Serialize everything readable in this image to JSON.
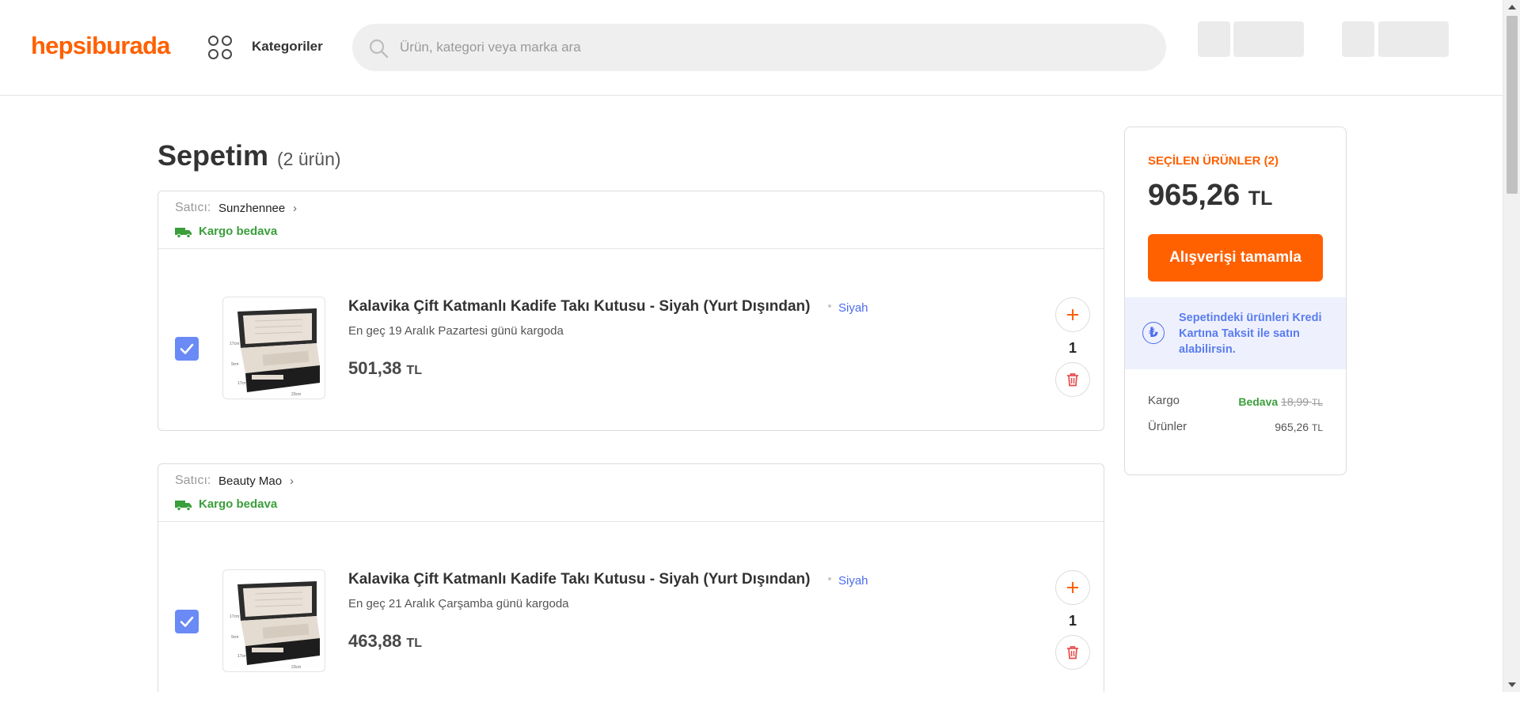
{
  "header": {
    "logo": "hepsiburada",
    "categories_label": "Kategoriler",
    "search_placeholder": "Ürün, kategori veya marka ara"
  },
  "page": {
    "title": "Sepetim",
    "count": "(2 ürün)"
  },
  "groups": [
    {
      "seller_label": "Satıcı:",
      "seller_name": "Sunzhennee",
      "shipping": "Kargo bedava",
      "item": {
        "title": "Kalavika Çift Katmanlı Kadife Takı Kutusu - Siyah (Yurt Dışından)",
        "variant": "Siyah",
        "delivery": "En geç 19 Aralık Pazartesi günü kargoda",
        "price": "501,38",
        "currency": "TL",
        "quantity": "1",
        "checked": true
      }
    },
    {
      "seller_label": "Satıcı:",
      "seller_name": "Beauty Mao",
      "shipping": "Kargo bedava",
      "item": {
        "title": "Kalavika Çift Katmanlı Kadife Takı Kutusu - Siyah (Yurt Dışından)",
        "variant": "Siyah",
        "delivery": "En geç 21 Aralık Çarşamba günü kargoda",
        "price": "463,88",
        "currency": "TL",
        "quantity": "1",
        "checked": true
      }
    }
  ],
  "summary": {
    "selected_label": "SEÇİLEN ÜRÜNLER (2)",
    "total": "965,26",
    "currency": "TL",
    "checkout_label": "Alışverişi tamamla",
    "installment_icon": "₺",
    "installment_text": "Sepetindeki ürünleri Kredi Kartına Taksit ile satın alabilirsin.",
    "shipping_label": "Kargo",
    "shipping_free": "Bedava",
    "shipping_old": "18,99",
    "products_label": "Ürünler",
    "products_value": "965,26"
  },
  "colors": {
    "brand": "#ff6000",
    "accent_blue": "#6a8af5",
    "success": "#3a9e3a"
  },
  "icons": [
    "categories-icon",
    "search-icon",
    "truck-icon",
    "chevron-right-icon",
    "checkmark-icon",
    "plus-icon",
    "trash-icon",
    "lira-icon"
  ]
}
